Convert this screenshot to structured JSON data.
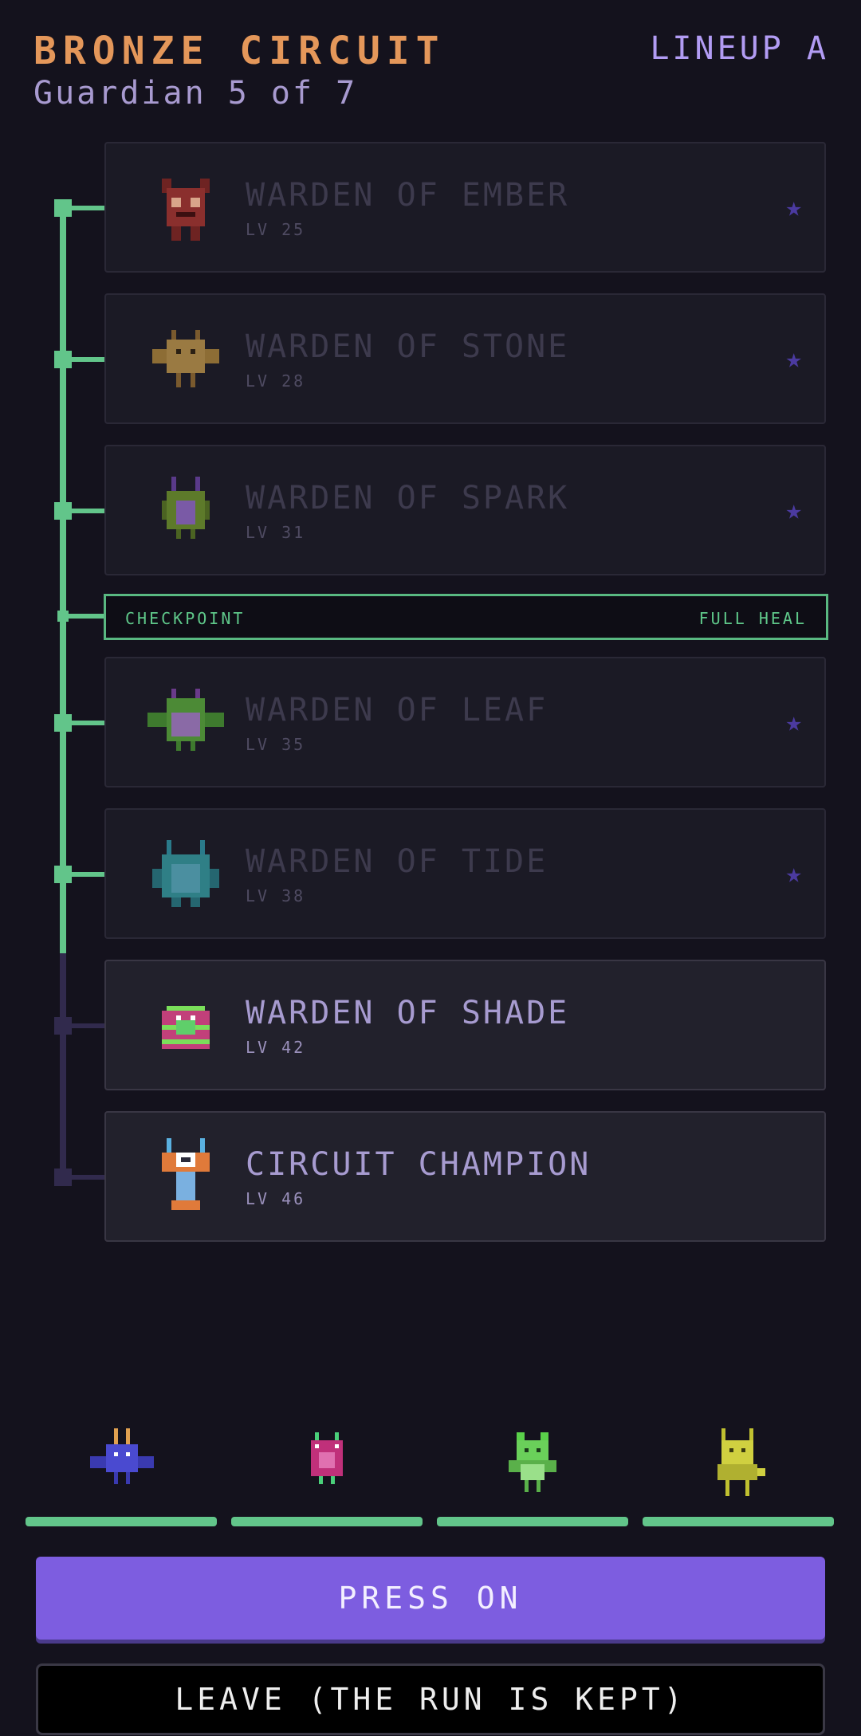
{
  "header": {
    "title": "BRONZE CIRCUIT",
    "subtitle": "Guardian 5 of 7",
    "lineup": "LINEUP A"
  },
  "guardians": [
    {
      "name": "WARDEN OF EMBER",
      "level": "LV 25",
      "status": "cleared",
      "sprite": "ember-warden-sprite"
    },
    {
      "name": "WARDEN OF STONE",
      "level": "LV 28",
      "status": "cleared",
      "sprite": "stone-warden-sprite"
    },
    {
      "name": "WARDEN OF SPARK",
      "level": "LV 31",
      "status": "cleared",
      "sprite": "spark-warden-sprite"
    },
    {
      "name": "WARDEN OF LEAF",
      "level": "LV 35",
      "status": "cleared",
      "sprite": "leaf-warden-sprite"
    },
    {
      "name": "WARDEN OF TIDE",
      "level": "LV 38",
      "status": "cleared",
      "sprite": "tide-warden-sprite"
    },
    {
      "name": "WARDEN OF SHADE",
      "level": "LV 42",
      "status": "next",
      "sprite": "shade-warden-sprite"
    },
    {
      "name": "CIRCUIT CHAMPION",
      "level": "LV 46",
      "status": "locked",
      "sprite": "champion-sprite"
    }
  ],
  "checkpoint": {
    "label": "CHECKPOINT",
    "reward": "FULL HEAL"
  },
  "party": [
    {
      "sprite": "blue-bat-sprite",
      "hp": 1.0
    },
    {
      "sprite": "pink-blob-sprite",
      "hp": 1.0
    },
    {
      "sprite": "green-imp-sprite",
      "hp": 1.0
    },
    {
      "sprite": "yellow-sprout-sprite",
      "hp": 1.0
    }
  ],
  "actions": {
    "press_on": "PRESS ON",
    "leave": "LEAVE (THE RUN IS KEPT)"
  },
  "colors": {
    "background": "#14121d",
    "title": "#e4975a",
    "accent": "#7d5de0",
    "rail_done": "#62c58a",
    "rail_pending": "#312a4d",
    "star": "#4b3aa0"
  }
}
